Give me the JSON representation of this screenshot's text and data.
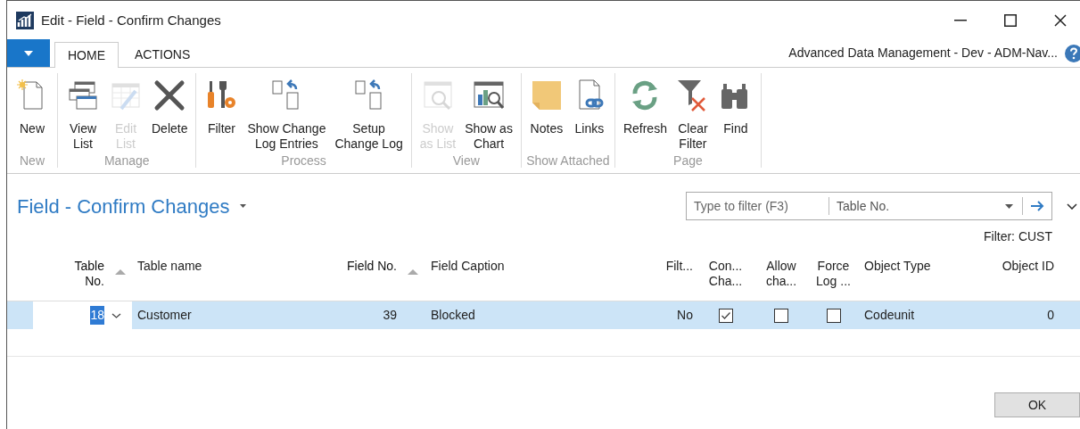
{
  "window": {
    "title": "Edit - Field - Confirm Changes"
  },
  "tabs": [
    {
      "label": "HOME",
      "selected": true
    },
    {
      "label": "ACTIONS",
      "selected": false
    }
  ],
  "company": "Advanced Data Management - Dev - ADM-Nav...",
  "ribbon": [
    {
      "label": "New",
      "buttons": [
        {
          "kind": "new",
          "label": "New",
          "disabled": false
        }
      ]
    },
    {
      "label": "Manage",
      "buttons": [
        {
          "kind": "viewlist",
          "label": "View\nList",
          "disabled": false
        },
        {
          "kind": "editlist",
          "label": "Edit\nList",
          "disabled": true
        },
        {
          "kind": "delete",
          "label": "Delete",
          "disabled": false
        }
      ]
    },
    {
      "label": "Process",
      "buttons": [
        {
          "kind": "filter",
          "label": "Filter",
          "disabled": false
        },
        {
          "kind": "changelog",
          "label": "Show Change\nLog Entries",
          "disabled": false
        },
        {
          "kind": "changelog",
          "label": "Setup\nChange Log",
          "disabled": false
        }
      ]
    },
    {
      "label": "View",
      "buttons": [
        {
          "kind": "showlist",
          "label": "Show\nas List",
          "disabled": true
        },
        {
          "kind": "chart",
          "label": "Show as\nChart",
          "disabled": false
        }
      ]
    },
    {
      "label": "Show Attached",
      "buttons": [
        {
          "kind": "notes",
          "label": "Notes",
          "disabled": false
        },
        {
          "kind": "links",
          "label": "Links",
          "disabled": false
        }
      ]
    },
    {
      "label": "Page",
      "buttons": [
        {
          "kind": "refresh",
          "label": "Refresh",
          "disabled": false
        },
        {
          "kind": "clearfilter",
          "label": "Clear\nFilter",
          "disabled": false
        },
        {
          "kind": "find",
          "label": "Find",
          "disabled": false
        }
      ]
    }
  ],
  "page_title": "Field - Confirm Changes",
  "filter_box": {
    "placeholder": "Type to filter (F3)",
    "field": "Table No."
  },
  "filter_text": "Filter: CUST",
  "table": {
    "columns": [
      {
        "label": "Table\nNo.",
        "sorted": true
      },
      {
        "label": "Table name",
        "sorted": false
      },
      {
        "label": "Field No.",
        "sorted": true
      },
      {
        "label": "Field Caption",
        "sorted": false
      },
      {
        "label": "Filt...",
        "sorted": false
      },
      {
        "label": "Con...\nCha...",
        "sorted": false
      },
      {
        "label": "Allow\ncha...",
        "sorted": false
      },
      {
        "label": "Force\nLog ...",
        "sorted": false
      },
      {
        "label": "Object Type",
        "sorted": false
      },
      {
        "label": "Object ID",
        "sorted": false
      }
    ],
    "rows": [
      {
        "selected": true,
        "cells": [
          {
            "kind": "edit",
            "text": "18"
          },
          {
            "kind": "text",
            "text": "Customer"
          },
          {
            "kind": "text",
            "text": "39"
          },
          {
            "kind": "text",
            "text": "Blocked"
          },
          {
            "kind": "text",
            "text": "No"
          },
          {
            "kind": "check",
            "checked": true
          },
          {
            "kind": "check",
            "checked": false
          },
          {
            "kind": "check",
            "checked": false
          },
          {
            "kind": "text",
            "text": "Codeunit"
          },
          {
            "kind": "text",
            "text": "0"
          }
        ]
      }
    ]
  },
  "buttons": [
    "OK"
  ]
}
